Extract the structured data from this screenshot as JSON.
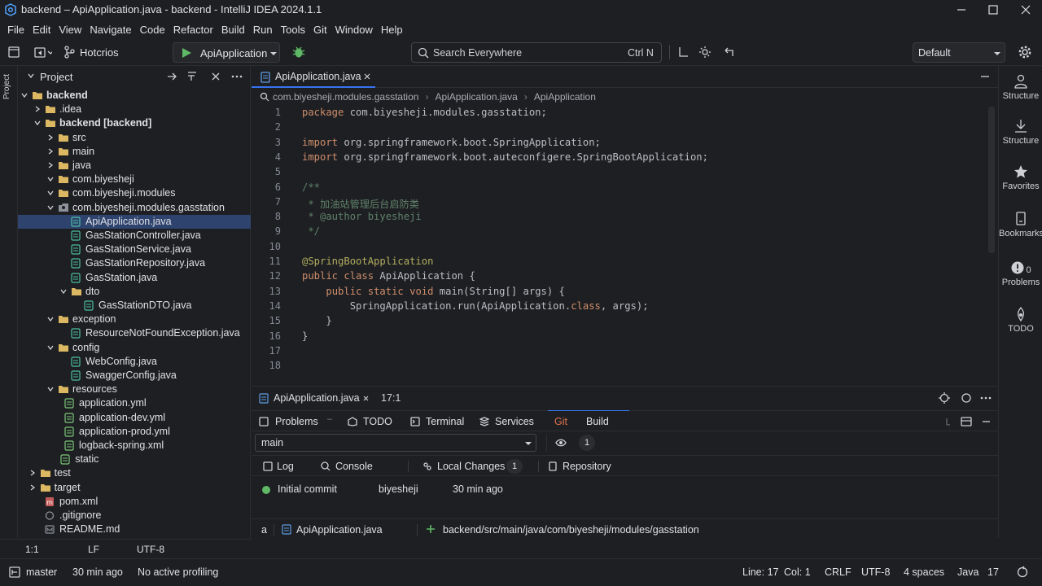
{
  "window": {
    "title": "backend – ApiApplication.java - backend - IntelliJ IDEA 2024.1.1"
  },
  "menu": [
    "File",
    "Edit",
    "View",
    "Navigate",
    "Code",
    "Refactor",
    "Build",
    "Run",
    "Tools",
    "Git",
    "Window",
    "Help"
  ],
  "toolbar": {
    "project_name": "Hotcrios",
    "run_config": "ApiApplication",
    "search_placeholder": "Search Everywhere",
    "search_shortcut": "Ctrl N",
    "profile": "Default"
  },
  "left_strip": {
    "label": "Project"
  },
  "project_panel": {
    "title": "Project",
    "tree": [
      {
        "label": "backend",
        "level": 0,
        "type": "folder",
        "expanded": true,
        "bold": true
      },
      {
        "label": ".idea",
        "level": 1,
        "type": "folder",
        "expanded": false
      },
      {
        "label": "backend [backend]",
        "level": 1,
        "type": "module",
        "expanded": true,
        "bold": true
      },
      {
        "label": "src",
        "level": 2,
        "type": "folder",
        "expanded": false
      },
      {
        "label": "main",
        "level": 2,
        "type": "folder",
        "expanded": false
      },
      {
        "label": "java",
        "level": 2,
        "type": "folder",
        "expanded": false
      },
      {
        "label": "com.biyesheji",
        "level": 2,
        "type": "folder",
        "expanded": true
      },
      {
        "label": "com.biyesheji.modules",
        "level": 2,
        "type": "folder",
        "expanded": true
      },
      {
        "label": "com.biyesheji.modules.gasstation",
        "level": 2,
        "type": "package",
        "expanded": true
      },
      {
        "label": "ApiApplication.java",
        "level": 3,
        "type": "java",
        "selected": true
      },
      {
        "label": "GasStationController.java",
        "level": 3,
        "type": "java"
      },
      {
        "label": "GasStationService.java",
        "level": 3,
        "type": "java"
      },
      {
        "label": "GasStationRepository.java",
        "level": 3,
        "type": "java"
      },
      {
        "label": "GasStation.java",
        "level": 3,
        "type": "java"
      },
      {
        "label": "dto",
        "level": 3,
        "type": "folder",
        "expanded": true
      },
      {
        "label": "GasStationDTO.java",
        "level": 4,
        "type": "java"
      },
      {
        "label": "exception",
        "level": 2,
        "type": "folder",
        "expanded": true
      },
      {
        "label": "ResourceNotFoundException.java",
        "level": 3,
        "type": "java"
      },
      {
        "label": "config",
        "level": 2,
        "type": "folder",
        "expanded": true
      },
      {
        "label": "WebConfig.java",
        "level": 3,
        "type": "java"
      },
      {
        "label": "SwaggerConfig.java",
        "level": 3,
        "type": "java"
      },
      {
        "label": "resources",
        "level": 2,
        "type": "folder",
        "expanded": true
      },
      {
        "label": "application.yml",
        "level": 2.5,
        "type": "yml"
      },
      {
        "label": "application-dev.yml",
        "level": 2.5,
        "type": "yml"
      },
      {
        "label": "application-prod.yml",
        "level": 2.5,
        "type": "yml"
      },
      {
        "label": "logback-spring.xml",
        "level": 2.5,
        "type": "yml"
      },
      {
        "label": "static",
        "level": 2.2,
        "type": "yml"
      },
      {
        "label": "test",
        "level": 0.6,
        "type": "folder",
        "expanded": false
      },
      {
        "label": "target",
        "level": 0.6,
        "type": "folder",
        "expanded": false
      },
      {
        "label": "pom.xml",
        "level": 1,
        "type": "xml"
      },
      {
        "label": ".gitignore",
        "level": 1,
        "type": "git"
      },
      {
        "label": "README.md",
        "level": 1,
        "type": "md"
      }
    ]
  },
  "editor": {
    "tab": "ApiApplication.java",
    "breadcrumbs": [
      "com.biyesheji.modules.gasstation",
      "ApiApplication.java",
      "ApiApplication"
    ],
    "lines": [
      "package com.biyesheji.modules.gasstation;",
      "",
      "import org.springframework.boot.SpringApplication;",
      "import org.springframework.boot.auteconfigere.SpringBootApplication;",
      "",
      "/**",
      " * 加油站管理后台启防类",
      " * @author biyesheji",
      " */",
      "",
      "@SpringBootApplication",
      "public class ApiApplication {",
      "    public static void main(String[] args) {",
      "        SpringApplication.run(ApiApplication.class, args);",
      "    }",
      "}",
      "",
      ""
    ],
    "line_numbers": [
      "1",
      "2",
      "3",
      "4",
      "5",
      "6",
      "7",
      "8",
      "9",
      "10",
      "11",
      "12",
      "13",
      "14",
      "15",
      "16",
      "17",
      "18"
    ]
  },
  "right_strip": [
    {
      "label": "Structure",
      "icon": "person-icon"
    },
    {
      "label": "Structure",
      "icon": "download-icon"
    },
    {
      "label": "Favorites",
      "icon": "star-icon"
    },
    {
      "label": "Bookmarks",
      "icon": "bookmark-icon"
    },
    {
      "label": "Problems",
      "icon": "problems-icon",
      "badge": "0"
    },
    {
      "label": "TODO",
      "icon": "todo-icon"
    }
  ],
  "bottom_panel": {
    "file_tab": "ApiApplication.java",
    "position": "17:1",
    "tabs": [
      "Problems",
      "TODO",
      "Terminal",
      "Services",
      "Git",
      "Build"
    ],
    "branch": "main",
    "count": "1",
    "subtabs": [
      "Log",
      "Console",
      "Local Changes",
      "Repository"
    ],
    "local_changes_count": "1",
    "commit": {
      "message": "Initial commit",
      "author": "biyesheji",
      "time": "30 min ago"
    },
    "path_row": {
      "prefix": "a",
      "file": "ApiApplication.java",
      "path": "backend/src/main/java/com/biyesheji/modules/gasstation"
    }
  },
  "status_left": {
    "pos": "1:1",
    "eol": "LF",
    "enc": "UTF-8"
  },
  "statusbar": {
    "branch": "master",
    "time": "30 min ago",
    "profiling": "No active profiling",
    "line": "Line: 17",
    "col": "Col: 1",
    "eol": "CRLF",
    "encoding": "UTF-8",
    "indent": "4 spaces",
    "lang": "Java",
    "version": "17"
  }
}
